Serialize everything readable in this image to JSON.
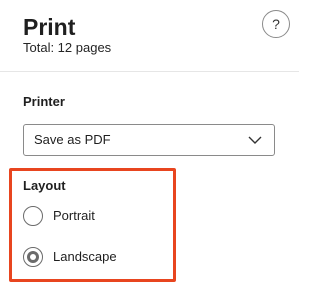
{
  "header": {
    "title": "Print",
    "subtitle": "Total: 12 pages",
    "help_glyph": "?"
  },
  "printer": {
    "label": "Printer",
    "selected": "Save as PDF"
  },
  "layout": {
    "label": "Layout",
    "options": [
      {
        "label": "Portrait",
        "checked": false
      },
      {
        "label": "Landscape",
        "checked": true
      }
    ]
  },
  "colors": {
    "highlight": "#e8451f",
    "radio_checked": "#6b6b6b"
  },
  "icons": {
    "help": "question-mark-icon",
    "dropdown": "chevron-down-icon"
  }
}
